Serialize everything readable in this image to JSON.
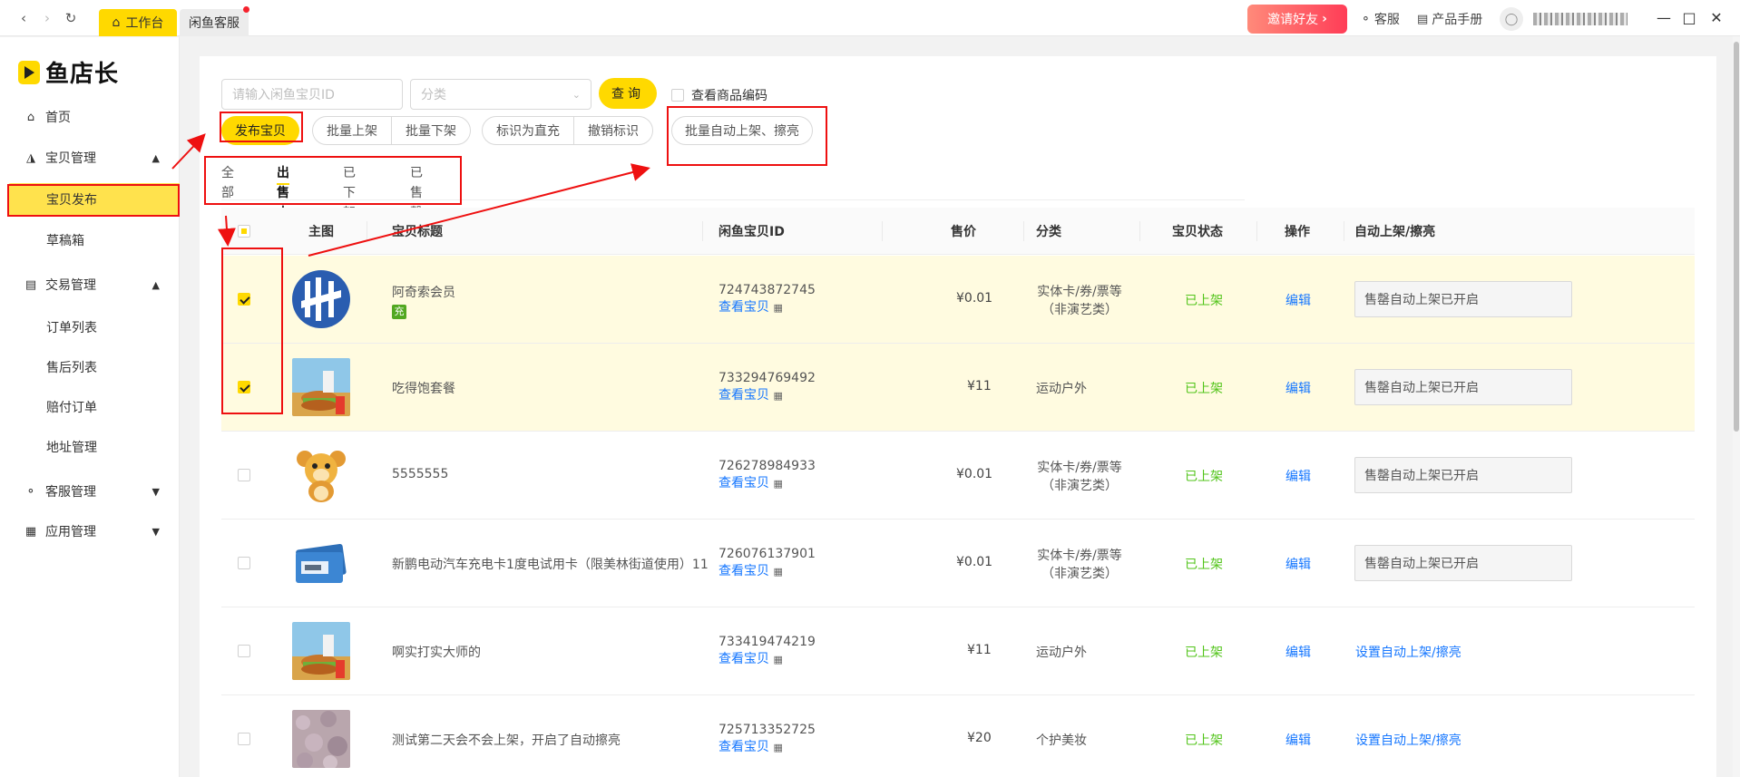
{
  "topbar": {
    "tabs": [
      {
        "label": "工作台"
      },
      {
        "label": "闲鱼客服"
      }
    ],
    "invite_label": "邀请好友",
    "service_label": "客服",
    "manual_label": "产品手册"
  },
  "sidebar": {
    "logo": "鱼店长",
    "groups": [
      {
        "label": "首页",
        "icon": "home-icon"
      },
      {
        "label": "宝贝管理",
        "icon": "bag-icon"
      },
      {
        "label": "交易管理",
        "icon": "doc-icon"
      },
      {
        "label": "客服管理",
        "icon": "headset-icon"
      },
      {
        "label": "应用管理",
        "icon": "apps-icon"
      }
    ],
    "subs": [
      {
        "label": "宝贝发布"
      },
      {
        "label": "草稿箱"
      },
      {
        "label": "订单列表"
      },
      {
        "label": "售后列表"
      },
      {
        "label": "赔付订单"
      },
      {
        "label": "地址管理"
      }
    ]
  },
  "filters": {
    "search_placeholder": "请输入闲鱼宝贝ID",
    "category_placeholder": "分类",
    "query_label": "查询",
    "show_code_label": "查看商品编码"
  },
  "actions": {
    "publish": "发布宝贝",
    "batch_up": "批量上架",
    "batch_down": "批量下架",
    "mark_direct": "标识为直充",
    "unmark": "撤销标识",
    "batch_auto": "批量自动上架、擦亮"
  },
  "tabs": [
    {
      "label": "全部"
    },
    {
      "label": "出售中"
    },
    {
      "label": "已下架"
    },
    {
      "label": "已售罄"
    }
  ],
  "table": {
    "headers": [
      "主图",
      "宝贝标题",
      "闲鱼宝贝ID",
      "售价",
      "分类",
      "宝贝状态",
      "操作",
      "自动上架/擦亮"
    ],
    "view_label": "查看宝贝",
    "rows": [
      {
        "title": "阿奇索会员",
        "id": "724743872745",
        "price": "¥0.01",
        "category": "实体卡/券/票等",
        "category2": "（非演艺类）",
        "status": "已上架",
        "op": "编辑",
        "auto": "售罄自动上架已开启",
        "tag": "充"
      },
      {
        "title": "吃得饱套餐",
        "id": "733294769492",
        "price": "¥11",
        "category": "运动户外",
        "category2": "",
        "status": "已上架",
        "op": "编辑",
        "auto": "售罄自动上架已开启"
      },
      {
        "title": "5555555",
        "id": "726278984933",
        "price": "¥0.01",
        "category": "实体卡/券/票等",
        "category2": "（非演艺类）",
        "status": "已上架",
        "op": "编辑",
        "auto": "售罄自动上架已开启"
      },
      {
        "title": "新鹏电动汽车充电卡1度电试用卡（限美林街道使用）11",
        "id": "726076137901",
        "price": "¥0.01",
        "category": "实体卡/券/票等",
        "category2": "（非演艺类）",
        "status": "已上架",
        "op": "编辑",
        "auto": "售罄自动上架已开启"
      },
      {
        "title": "啊实打实大师的",
        "id": "733419474219",
        "price": "¥11",
        "category": "运动户外",
        "category2": "",
        "status": "已上架",
        "op": "编辑",
        "auto_link": "设置自动上架/擦亮"
      },
      {
        "title": "测试第二天会不会上架，开启了自动擦亮",
        "id": "725713352725",
        "price": "¥20",
        "category": "个护美妆",
        "category2": "",
        "status": "已上架",
        "op": "编辑",
        "auto_link": "设置自动上架/擦亮"
      }
    ]
  },
  "colors": {
    "accent": "#ffd900",
    "link": "#1677ff",
    "status_green": "#52c41a",
    "annotation_red": "#ee1010",
    "selected_row": "#fffbe0"
  }
}
